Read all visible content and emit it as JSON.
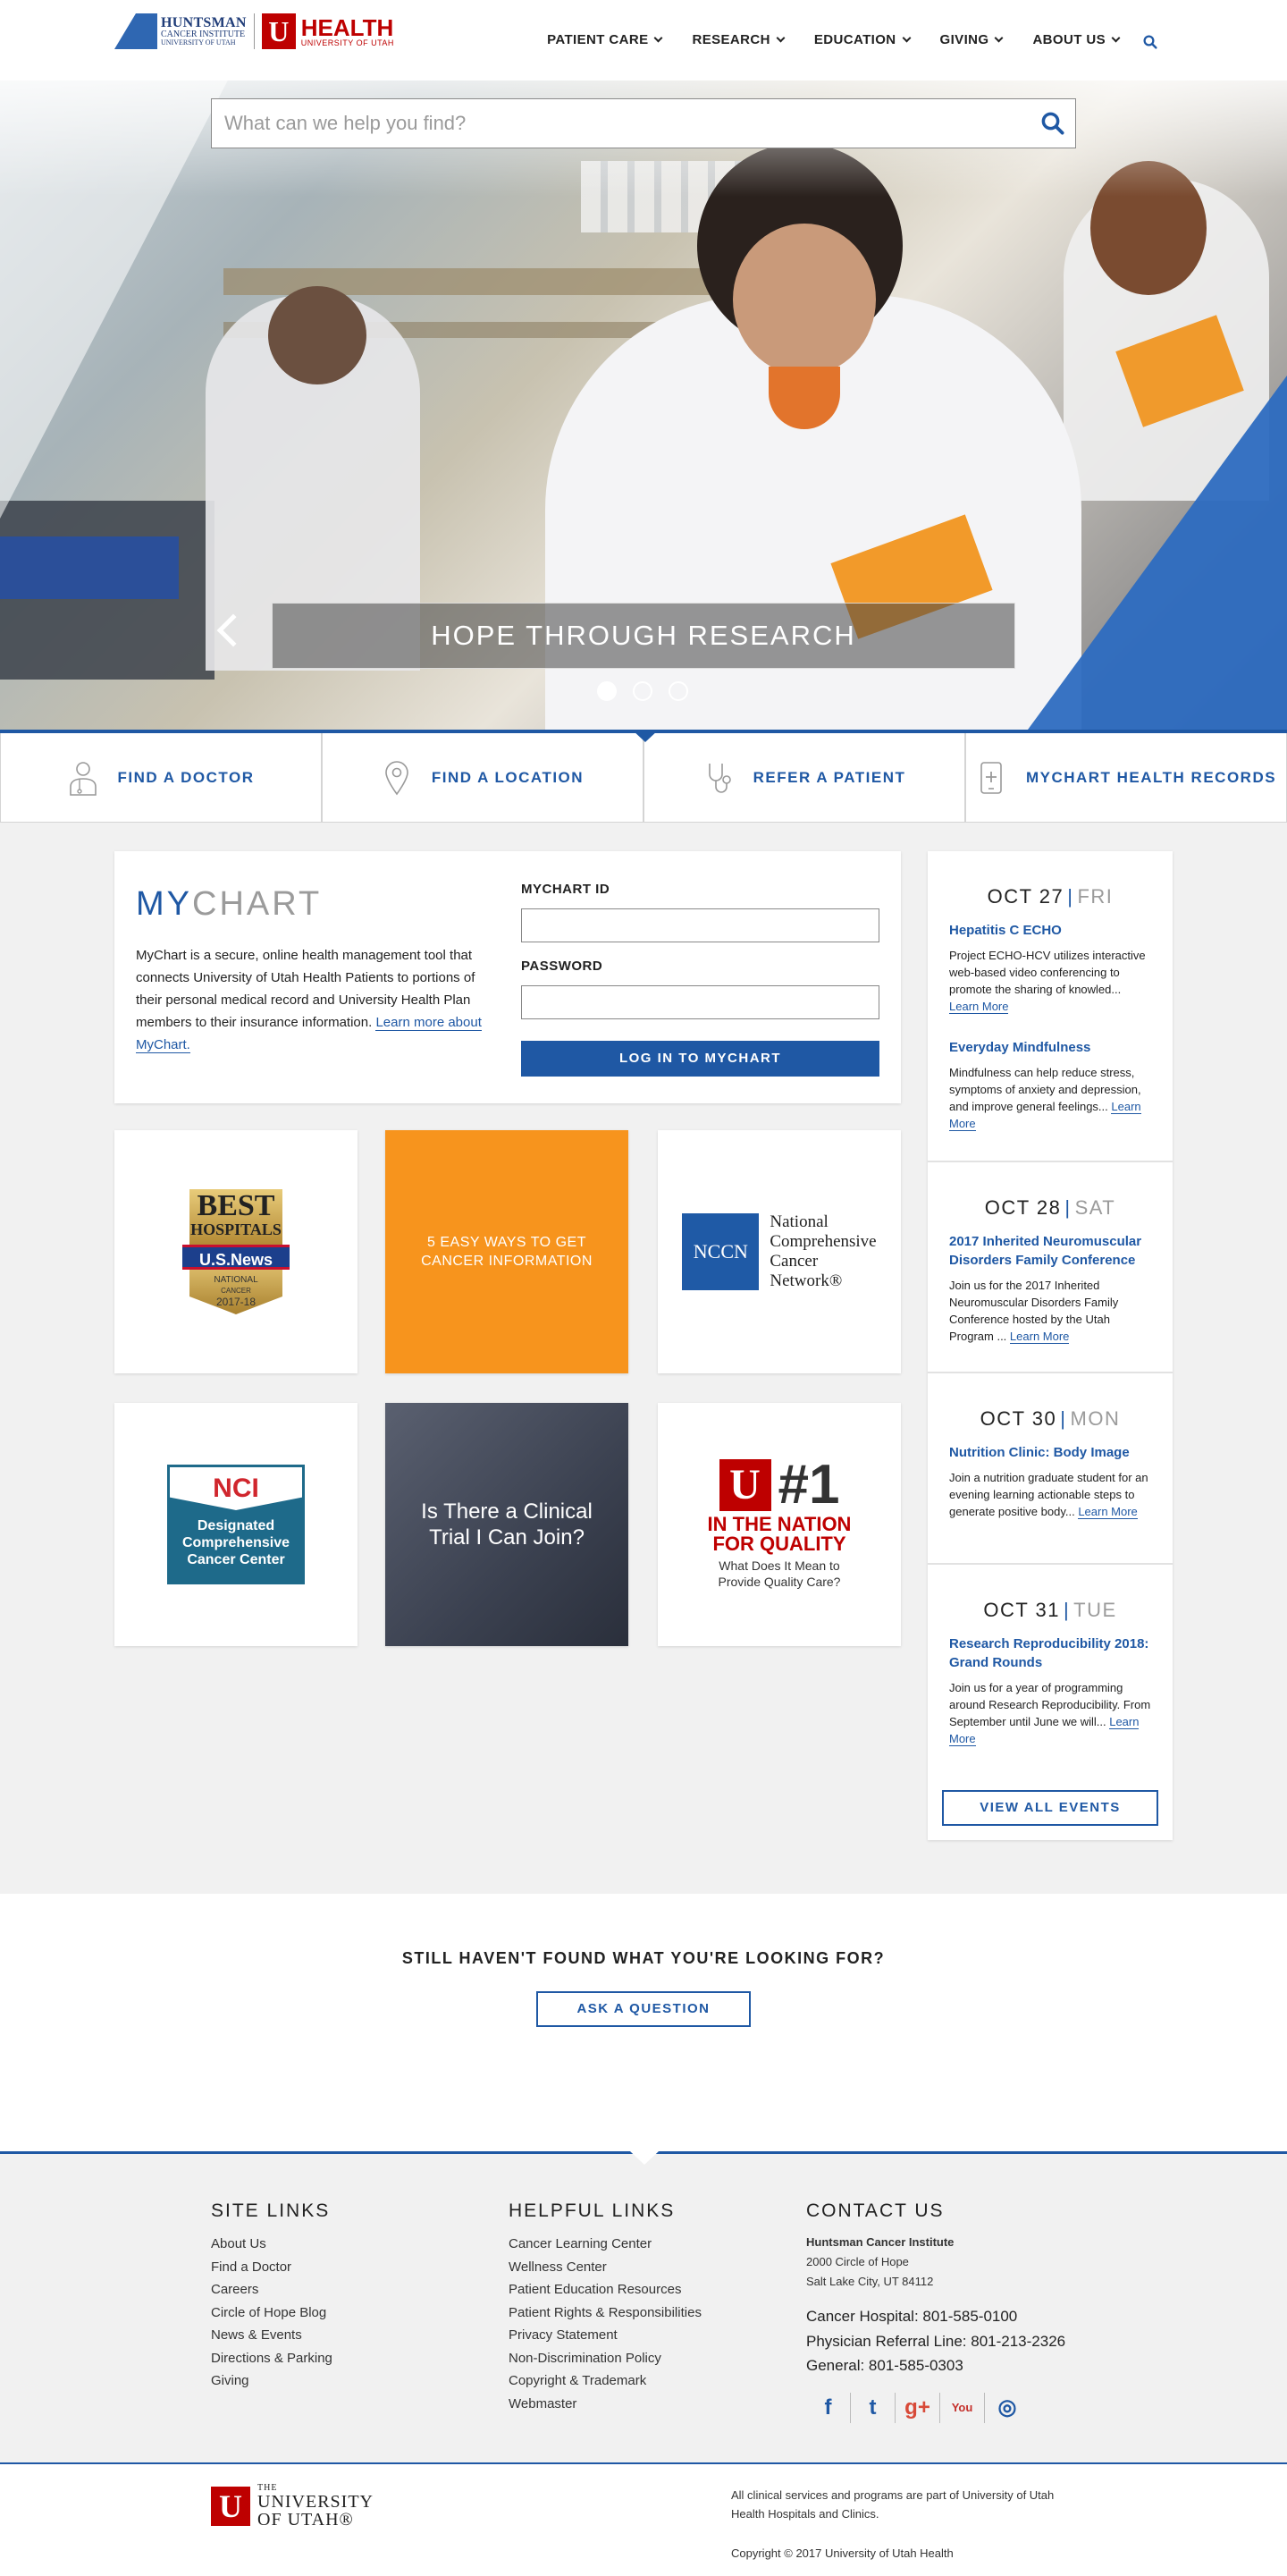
{
  "header": {
    "hci_logo": {
      "line1": "HUNTSMAN",
      "line2": "CANCER INSTITUTE",
      "line3": "UNIVERSITY OF UTAH"
    },
    "uhealth_logo": {
      "mark": "U",
      "line1": "HEALTH",
      "line2": "UNIVERSITY OF UTAH"
    },
    "nav": [
      {
        "label": "PATIENT CARE"
      },
      {
        "label": "RESEARCH"
      },
      {
        "label": "EDUCATION"
      },
      {
        "label": "GIVING"
      },
      {
        "label": "ABOUT US"
      }
    ]
  },
  "hero": {
    "search_placeholder": "What can we help you find?",
    "caption": "HOPE THROUGH RESEARCH",
    "active_slide": 1,
    "slide_count": 3
  },
  "quick_links": [
    {
      "label": "FIND A DOCTOR",
      "icon": "doctor-icon"
    },
    {
      "label": "FIND A LOCATION",
      "icon": "location-pin-icon"
    },
    {
      "label": "REFER A PATIENT",
      "icon": "stethoscope-icon"
    },
    {
      "label": "MYCHART HEALTH RECORDS",
      "icon": "mobile-health-icon"
    }
  ],
  "mychart": {
    "title_accent": "MY",
    "title_rest": "CHART",
    "description": "MyChart is a secure, online health management tool that connects University of Utah Health Patients to portions of their personal medical record and University Health Plan members to their insurance information.",
    "learn_more": "Learn more about MyChart.",
    "id_label": "MYCHART ID",
    "password_label": "PASSWORD",
    "login_button": "LOG IN TO MYCHART"
  },
  "tiles": {
    "best": {
      "line1": "BEST",
      "line2": "HOSPITALS",
      "band": "U.S.News",
      "sub1": "NATIONAL",
      "sub2": "CANCER",
      "years": "2017-18"
    },
    "easy_ways": "5 EASY WAYS TO GET CANCER INFORMATION",
    "nccn": {
      "box": "NCCN",
      "line1": "National",
      "line2": "Comprehensive",
      "line3": "Cancer",
      "line4": "Network®"
    },
    "nci": {
      "top": "NCI",
      "line1": "Designated",
      "line2": "Comprehensive",
      "line3": "Cancer Center"
    },
    "trial": "Is There a Clinical Trial I Can Join?",
    "quality": {
      "mark": "U",
      "number": "#1",
      "red1": "IN THE NATION",
      "red2": "FOR QUALITY",
      "sub1": "What Does It Mean to",
      "sub2": "Provide Quality Care?"
    }
  },
  "events": [
    {
      "date": "OCT 27",
      "day": "FRI",
      "items": [
        {
          "title": "Hepatitis C ECHO",
          "desc": "Project ECHO-HCV utilizes interactive web-based video conferencing to promote the sharing of knowled...",
          "link": "Learn More"
        },
        {
          "title": "Everyday Mindfulness",
          "desc": "Mindfulness can help reduce stress, symptoms of anxiety and depression, and improve general feelings...",
          "link": "Learn More"
        }
      ]
    },
    {
      "date": "OCT 28",
      "day": "SAT",
      "items": [
        {
          "title": "2017 Inherited Neuromuscular Disorders Family Conference",
          "desc": "Join us for the 2017 Inherited Neuromuscular Disorders Family Conference hosted by the Utah Program ...",
          "link": "Learn More"
        }
      ]
    },
    {
      "date": "OCT 30",
      "day": "MON",
      "items": [
        {
          "title": "Nutrition Clinic: Body Image",
          "desc": "Join a nutrition graduate student for an evening learning actionable steps to generate positive body...",
          "link": "Learn More"
        }
      ]
    },
    {
      "date": "OCT 31",
      "day": "TUE",
      "items": [
        {
          "title": "Research Reproducibility 2018: Grand Rounds",
          "desc": "Join us for a year of programming around Research Reproducibility. From September until June we will...",
          "link": "Learn More"
        }
      ]
    }
  ],
  "view_all": "VIEW ALL EVENTS",
  "still": {
    "heading": "STILL HAVEN'T FOUND WHAT YOU'RE LOOKING FOR?",
    "button": "ASK A QUESTION"
  },
  "footer": {
    "site_links_title": "SITE LINKS",
    "site_links": [
      "About Us",
      "Find a Doctor",
      "Careers",
      "Circle of Hope Blog",
      "News & Events",
      "Directions & Parking",
      "Giving"
    ],
    "helpful_title": "HELPFUL LINKS",
    "helpful_links": [
      "Cancer Learning Center",
      "Wellness Center",
      "Patient Education Resources",
      "Patient Rights & Responsibilities",
      "Privacy Statement",
      "Non-Discrimination Policy",
      "Copyright & Trademark",
      "Webmaster"
    ],
    "contact_title": "CONTACT US",
    "org": "Huntsman Cancer Institute",
    "address1": "2000 Circle of Hope",
    "address2": "Salt Lake City, UT 84112",
    "phones": [
      "Cancer Hospital: 801-585-0100",
      "Physician Referral Line: 801-213-2326",
      "General: 801-585-0303"
    ],
    "social": [
      {
        "icon": "facebook-icon",
        "glyph": "f"
      },
      {
        "icon": "twitter-icon",
        "glyph": "t"
      },
      {
        "icon": "google-plus-icon",
        "glyph": "g+"
      },
      {
        "icon": "youtube-icon",
        "glyph": "You"
      },
      {
        "icon": "instagram-icon",
        "glyph": "◎"
      }
    ]
  },
  "bottom": {
    "uu_mark": "U",
    "uu_line1": "THE",
    "uu_line2": "UNIVERSITY",
    "uu_line3": "OF UTAH®",
    "disclaimer": "All clinical services and programs are part of University of Utah Health Hospitals and Clinics.",
    "copyright": "Copyright © 2017 University of Utah Health"
  },
  "colors": {
    "brand_blue": "#1f58a4",
    "utah_red": "#be0000",
    "orange": "#f7941d"
  }
}
